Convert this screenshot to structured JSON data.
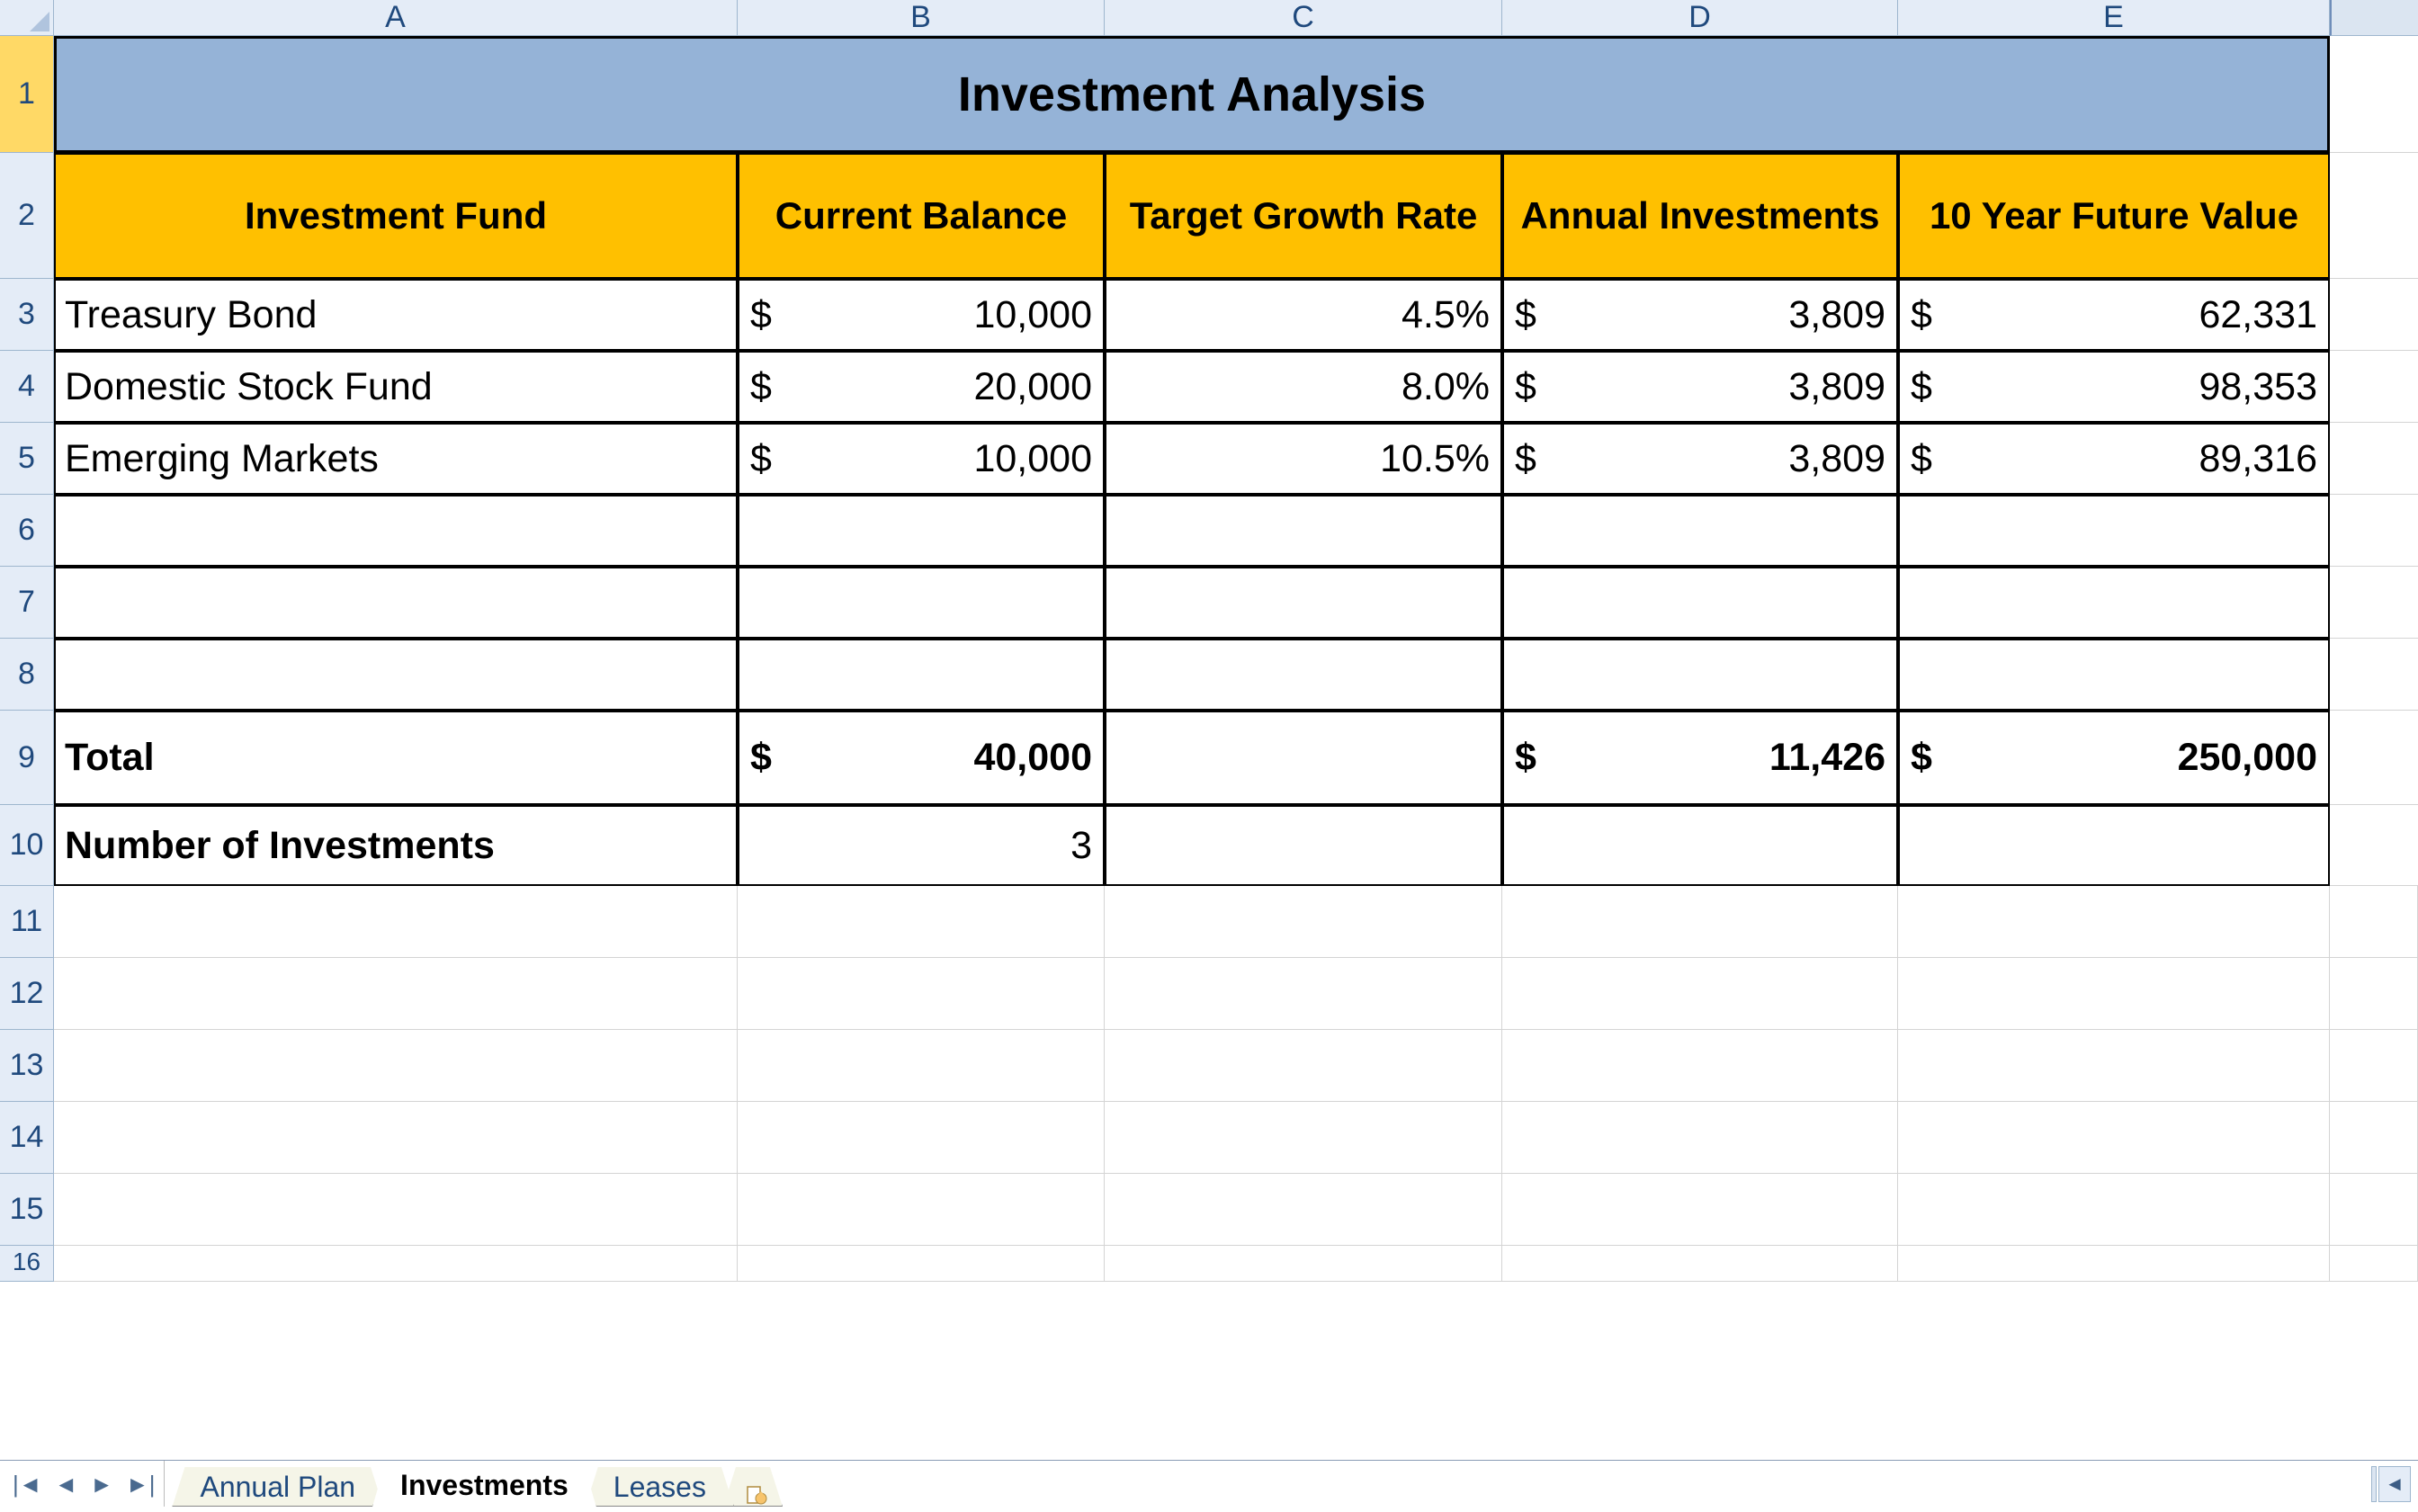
{
  "columns": [
    "A",
    "B",
    "C",
    "D",
    "E"
  ],
  "rows_shown": [
    "1",
    "2",
    "3",
    "4",
    "5",
    "6",
    "7",
    "8",
    "9",
    "10",
    "11",
    "12",
    "13",
    "14",
    "15",
    "16"
  ],
  "title": "Investment Analysis",
  "headers": {
    "fund": "Investment Fund",
    "current_balance": "Current Balance",
    "target_growth": "Target Growth Rate",
    "annual_investments": "Annual Investments",
    "future_value": "10 Year Future Value"
  },
  "data": [
    {
      "fund": "Treasury Bond",
      "current_balance": "10,000",
      "rate": "4.5%",
      "annual": "3,809",
      "future": "62,331"
    },
    {
      "fund": "Domestic Stock Fund",
      "current_balance": "20,000",
      "rate": "8.0%",
      "annual": "3,809",
      "future": "98,353"
    },
    {
      "fund": "Emerging Markets",
      "current_balance": "10,000",
      "rate": "10.5%",
      "annual": "3,809",
      "future": "89,316"
    }
  ],
  "totals": {
    "label": "Total",
    "current_balance": "40,000",
    "rate": "",
    "annual": "11,426",
    "future": "250,000"
  },
  "num_investments": {
    "label": "Number of Investments",
    "value": "3"
  },
  "dollar_sign": "$",
  "tabs": {
    "prev": "Annual Plan",
    "active": "Investments",
    "next": "Leases"
  }
}
